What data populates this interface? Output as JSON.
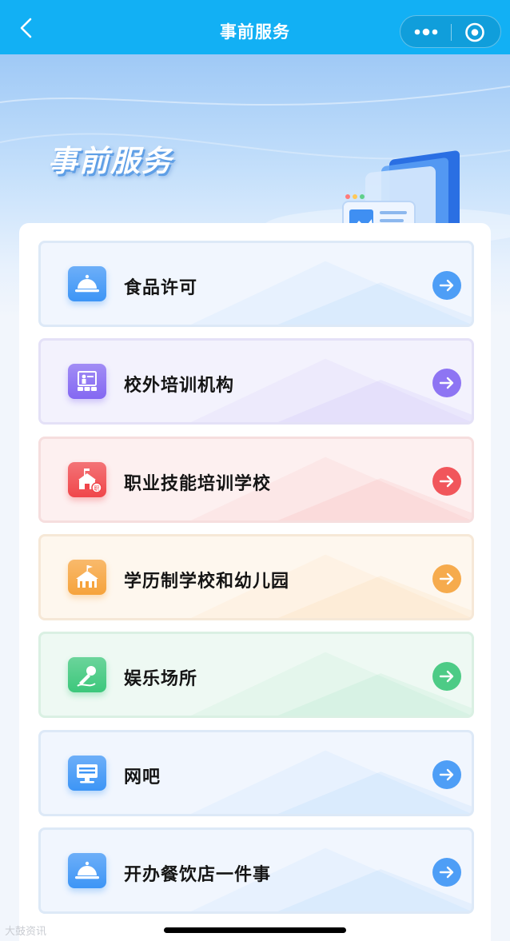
{
  "nav": {
    "title": "事前服务",
    "back_icon": "chevron-left-icon",
    "more_icon": "more-dots-icon",
    "close_icon": "target-close-icon"
  },
  "hero": {
    "title": "事前服务"
  },
  "services": [
    {
      "label": "食品许可",
      "icon": "food-cloche-icon",
      "theme": "blue",
      "accent": "#3d95f6",
      "bg": "#f1f6fe",
      "border": "#dde9f7"
    },
    {
      "label": "校外培训机构",
      "icon": "classroom-icon",
      "theme": "purple",
      "accent": "#8468f2",
      "bg": "#f3f2fd",
      "border": "#e4e1f7"
    },
    {
      "label": "职业技能培训学校",
      "icon": "vocational-school-icon",
      "theme": "red",
      "accent": "#f0464b",
      "bg": "#fdf0f0",
      "border": "#f6dede"
    },
    {
      "label": "学历制学校和幼儿园",
      "icon": "school-building-icon",
      "theme": "orange",
      "accent": "#f6a33c",
      "bg": "#fef7ee",
      "border": "#f6e8d7"
    },
    {
      "label": "娱乐场所",
      "icon": "microphone-icon",
      "theme": "green",
      "accent": "#3cc77b",
      "bg": "#eef9f3",
      "border": "#daf0e3"
    },
    {
      "label": "网吧",
      "icon": "desktop-computer-icon",
      "theme": "blue",
      "accent": "#3d95f6",
      "bg": "#f1f6fe",
      "border": "#dde9f7"
    },
    {
      "label": "开办餐饮店一件事",
      "icon": "food-cloche-icon",
      "theme": "blue",
      "accent": "#3d95f6",
      "bg": "#f1f6fe",
      "border": "#dde9f7"
    }
  ],
  "watermark": "大鼓资讯"
}
